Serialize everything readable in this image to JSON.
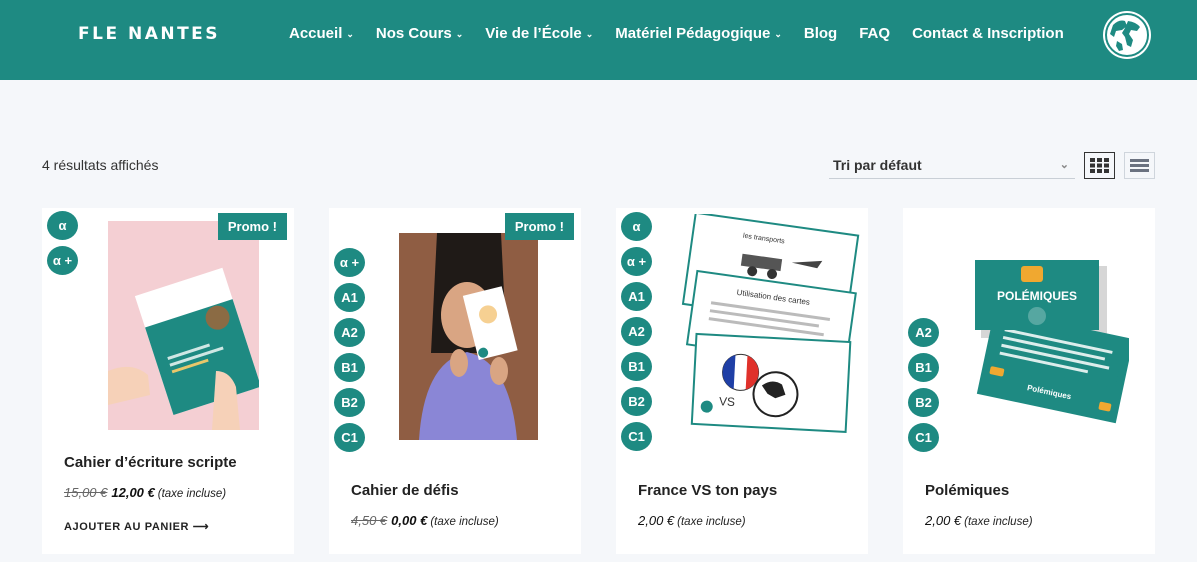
{
  "header": {
    "logo": "FLE NANTES",
    "nav": [
      {
        "label": "Accueil",
        "has_dropdown": true
      },
      {
        "label": "Nos Cours",
        "has_dropdown": true
      },
      {
        "label": "Vie de l’École",
        "has_dropdown": true
      },
      {
        "label": "Matériel Pédagogique",
        "has_dropdown": true
      },
      {
        "label": "Blog",
        "has_dropdown": false
      },
      {
        "label": "FAQ",
        "has_dropdown": false
      },
      {
        "label": "Contact & Inscription",
        "has_dropdown": false
      }
    ],
    "globe_icon": "globe-icon"
  },
  "toolbar": {
    "results_text": "4 résultats affichés",
    "sort_selected": "Tri par défaut",
    "grid_view_icon": "grid-icon",
    "list_view_icon": "list-icon"
  },
  "products": [
    {
      "levels": [
        "α",
        "α +"
      ],
      "promo": "Promo !",
      "name": "Cahier d’écriture scripte",
      "old_price": "15,00 €",
      "price": "12,00 €",
      "tax": "(taxe incluse)",
      "cta": "AJOUTER AU PANIER"
    },
    {
      "levels": [
        "α +",
        "A1",
        "A2",
        "B1",
        "B2",
        "C1"
      ],
      "promo": "Promo !",
      "name": "Cahier de défis",
      "old_price": "4,50 €",
      "price": "0,00 €",
      "tax": "(taxe incluse)"
    },
    {
      "levels": [
        "α",
        "α +",
        "A1",
        "A2",
        "B1",
        "B2",
        "C1"
      ],
      "name": "France VS ton pays",
      "price": "2,00 €",
      "tax": "(taxe incluse)",
      "image_text": {
        "c1": "les transports",
        "c2": "Utilisation des cartes",
        "c3": "VS"
      }
    },
    {
      "levels": [
        "A2",
        "B1",
        "B2",
        "C1"
      ],
      "name": "Polémiques",
      "price": "2,00 €",
      "tax": "(taxe incluse)",
      "image_text": {
        "title": "POLÉMIQUES",
        "back": "Polémiques"
      }
    }
  ],
  "colors": {
    "brand": "#1e8a82",
    "background": "#f5f7fa"
  }
}
